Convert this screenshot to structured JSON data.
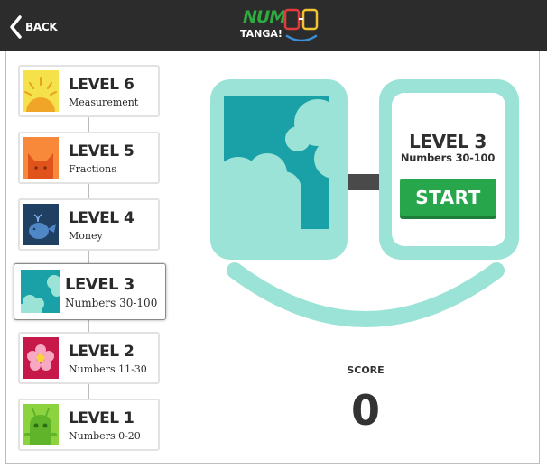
{
  "header": {
    "back_label": "BACK",
    "logo": {
      "top": "NUM",
      "bottom": "TANGA!"
    }
  },
  "levels": [
    {
      "title": "LEVEL 6",
      "subtitle": "Measurement",
      "icon": "sun-icon",
      "color": "#f5e24a"
    },
    {
      "title": "LEVEL 5",
      "subtitle": "Fractions",
      "icon": "cat-icon",
      "color": "#f9893a"
    },
    {
      "title": "LEVEL 4",
      "subtitle": "Money",
      "icon": "whale-icon",
      "color": "#1f3f63"
    },
    {
      "title": "LEVEL 3",
      "subtitle": "Numbers 30-100",
      "icon": "clouds-icon",
      "color": "#1aa1a8",
      "selected": true
    },
    {
      "title": "LEVEL 2",
      "subtitle": "Numbers 11-30",
      "icon": "flower-icon",
      "color": "#c7184a"
    },
    {
      "title": "LEVEL 1",
      "subtitle": "Numbers 0-20",
      "icon": "alien-icon",
      "color": "#8dd33f"
    }
  ],
  "selected_level": {
    "title": "LEVEL 3",
    "subtitle": "Numbers 30-100",
    "start_label": "START"
  },
  "score": {
    "label": "SCORE",
    "value": "0"
  },
  "colors": {
    "topbar": "#2c2c2c",
    "accent_mint": "#9be3d6",
    "teal": "#1aa1a8",
    "start_green": "#27a64c",
    "logo_green": "#2eaa3f"
  }
}
